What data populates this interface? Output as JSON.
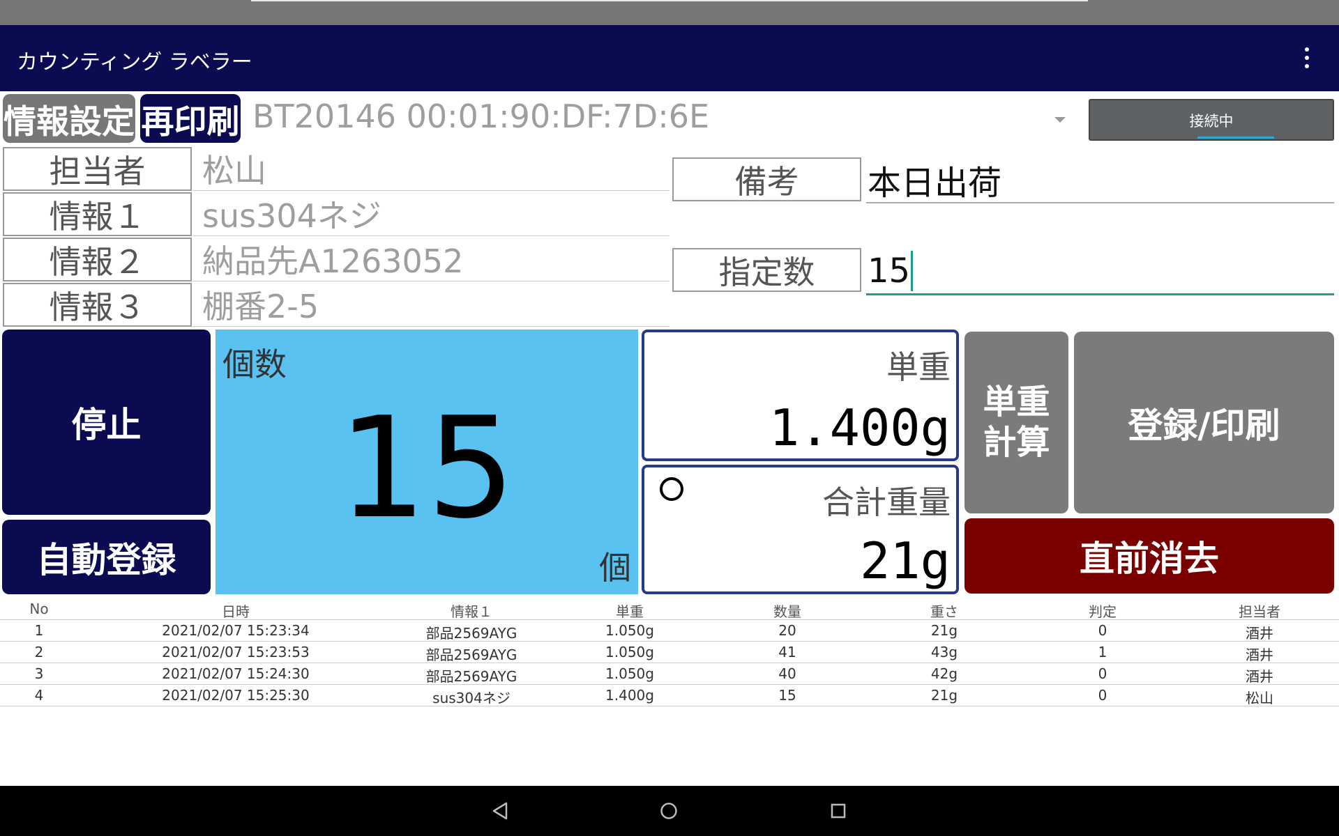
{
  "app": {
    "title": "カウンティング ラベラー"
  },
  "toolbar": {
    "info_settings": "情報設定",
    "reprint": "再印刷",
    "device": "BT20146 00:01:90:DF:7D:6E",
    "connection_status": "接続中"
  },
  "fields": {
    "operator": {
      "label": "担当者",
      "value": "松山"
    },
    "info1": {
      "label": "情報１",
      "value": "sus304ネジ"
    },
    "info2": {
      "label": "情報２",
      "value": "納品先A1263052"
    },
    "info3": {
      "label": "情報３",
      "value": "棚番2-5"
    },
    "remarks": {
      "label": "備考",
      "value": "本日出荷"
    },
    "target_count": {
      "label": "指定数",
      "value": "15"
    }
  },
  "buttons": {
    "stop": "停止",
    "auto_register": "自動登録",
    "unit_calc_line1": "単重",
    "unit_calc_line2": "計算",
    "register_print": "登録/印刷",
    "undo_last": "直前消去"
  },
  "count": {
    "label": "個数",
    "value": "15",
    "unit": "個"
  },
  "unit_weight": {
    "label": "単重",
    "value": "1.400g"
  },
  "total_weight": {
    "label": "合計重量",
    "value": "21g",
    "stable_indicator": "circle"
  },
  "table": {
    "headers": [
      "No",
      "日時",
      "情報１",
      "単重",
      "数量",
      "重さ",
      "判定",
      "担当者"
    ],
    "rows": [
      [
        "1",
        "2021/02/07 15:23:34",
        "部品2569AYG",
        "1.050g",
        "20",
        "21g",
        "0",
        "酒井"
      ],
      [
        "2",
        "2021/02/07 15:23:53",
        "部品2569AYG",
        "1.050g",
        "41",
        "43g",
        "1",
        "酒井"
      ],
      [
        "3",
        "2021/02/07 15:24:30",
        "部品2569AYG",
        "1.050g",
        "40",
        "42g",
        "0",
        "酒井"
      ],
      [
        "4",
        "2021/02/07 15:25:30",
        "sus304ネジ",
        "1.400g",
        "15",
        "21g",
        "0",
        "松山"
      ]
    ]
  },
  "colors": {
    "primary": "#0b0b52",
    "count_bg": "#59c2f0",
    "undo": "#7a0000",
    "gray_button": "#7b7b7b",
    "accent_underline": "#2fa8d8"
  },
  "icons": {
    "menu": "more-vert-icon",
    "dropdown": "dropdown-arrow-icon",
    "nav_back": "back-triangle-icon",
    "nav_home": "home-circle-icon",
    "nav_recent": "recent-square-icon"
  }
}
